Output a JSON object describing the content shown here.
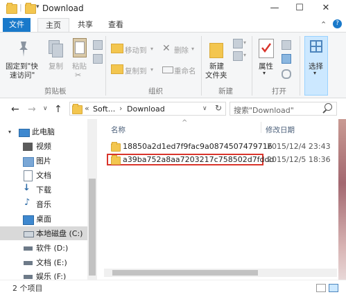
{
  "window": {
    "title": "Download",
    "colors": {
      "accent": "#1979ca",
      "highlight": "#d9342b",
      "selection": "#cce8ff"
    }
  },
  "titlebar": {
    "qat_divider": "|",
    "qat_dropdown": "▾",
    "minimize": "—",
    "maximize": "☐",
    "close": "✕"
  },
  "tabs": {
    "file": "文件",
    "home": "主页",
    "share": "共享",
    "view": "查看"
  },
  "ribbon_controls": {
    "collapse": "⌃",
    "help": "?"
  },
  "ribbon": {
    "clipboard": {
      "pin_line1": "固定到\"快",
      "pin_line2": "速访问\"",
      "copy": "复制",
      "paste": "粘贴",
      "group": "剪贴板"
    },
    "organize": {
      "move_to": "移动到",
      "copy_to": "复制到",
      "delete": "删除",
      "rename": "重命名",
      "group": "组织"
    },
    "new": {
      "new_folder_line1": "新建",
      "new_folder_line2": "文件夹",
      "group": "新建"
    },
    "open": {
      "properties": "属性",
      "group": "打开"
    },
    "select": {
      "select": "选择"
    }
  },
  "nav": {
    "back": "←",
    "forward": "→",
    "history": "∨",
    "up": "↑",
    "breadcrumb_overflow": "«",
    "breadcrumb_1": "Soft...",
    "breadcrumb_sep": "›",
    "breadcrumb_2": "Download",
    "address_dropdown": "∨",
    "refresh": "↻",
    "search_placeholder": "搜索\"Download\""
  },
  "sidebar": {
    "items": [
      {
        "label": "此电脑",
        "icon": "pc-icon"
      },
      {
        "label": "视频",
        "icon": "video-icon"
      },
      {
        "label": "图片",
        "icon": "pictures-icon"
      },
      {
        "label": "文档",
        "icon": "documents-icon"
      },
      {
        "label": "下载",
        "icon": "download-icon"
      },
      {
        "label": "音乐",
        "icon": "music-icon"
      },
      {
        "label": "桌面",
        "icon": "desktop-icon"
      },
      {
        "label": "本地磁盘 (C:)",
        "icon": "drive-icon"
      },
      {
        "label": "软件 (D:)",
        "icon": "drive-icon"
      },
      {
        "label": "文档 (E:)",
        "icon": "drive-icon"
      },
      {
        "label": "娱乐 (F:)",
        "icon": "drive-icon"
      }
    ]
  },
  "filelist": {
    "sort_arrow": "^",
    "columns": {
      "name": "名称",
      "modified": "修改日期"
    },
    "rows": [
      {
        "name": "18850a2d1ed7f9fac9a0874507479716",
        "modified": "2015/12/4 23:43"
      },
      {
        "name": "a39ba752a8aa7203217c758502d7fddd",
        "modified": "2015/12/5 18:36"
      }
    ]
  },
  "status": {
    "count": "2 个项目"
  }
}
